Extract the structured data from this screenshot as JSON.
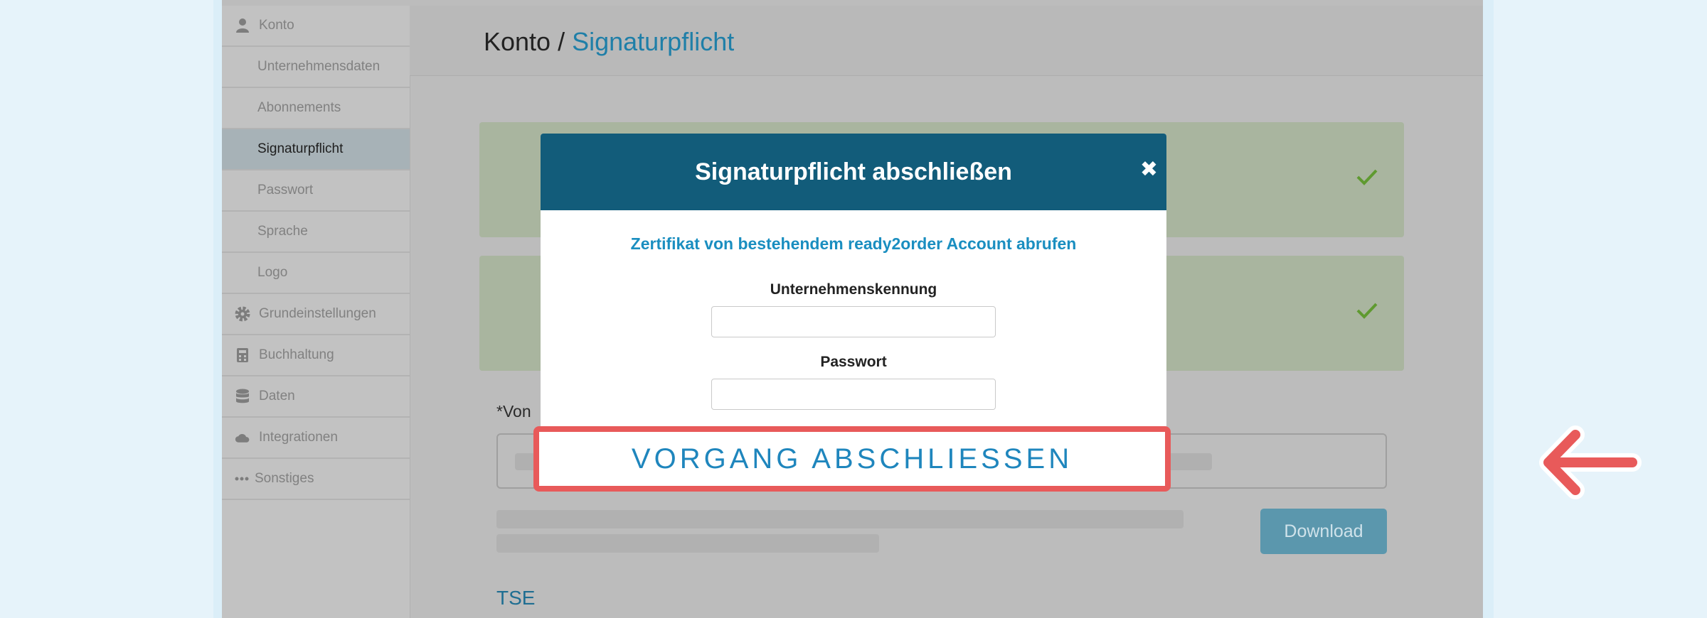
{
  "sidebar": {
    "items": [
      {
        "label": "Konto",
        "icon": "user-icon"
      },
      {
        "label": "Unternehmensdaten"
      },
      {
        "label": "Abonnements"
      },
      {
        "label": "Signaturpflicht"
      },
      {
        "label": "Passwort"
      },
      {
        "label": "Sprache"
      },
      {
        "label": "Logo"
      },
      {
        "label": "Grundeinstellungen",
        "icon": "gear-icon"
      },
      {
        "label": "Buchhaltung",
        "icon": "calculator-icon"
      },
      {
        "label": "Daten",
        "icon": "database-icon"
      },
      {
        "label": "Integrationen",
        "icon": "cloud-icon"
      },
      {
        "label": "Sonstiges",
        "icon": "more-dots-icon"
      }
    ],
    "active": "Signaturpflicht"
  },
  "header": {
    "breadcrumb_parent": "Konto",
    "breadcrumb_separator": " / ",
    "breadcrumb_current": "Signaturpflicht"
  },
  "main": {
    "von_label": "*Von",
    "download_label": "Download",
    "tse_heading": "TSE"
  },
  "modal": {
    "title": "Signaturpflicht abschließen",
    "close_symbol": "✖",
    "subtitle": "Zertifikat von bestehendem ready2order Account abrufen",
    "company_id_label": "Unternehmenskennung",
    "company_id_value": "",
    "password_label": "Passwort",
    "password_value": "",
    "submit_label": "VORGANG ABSCHLIESSEN"
  },
  "colors": {
    "modal_header": "#125c7a",
    "accent_blue": "#1a8ec0",
    "highlight_red": "#e85a5a",
    "check_green": "#5f9a30"
  }
}
